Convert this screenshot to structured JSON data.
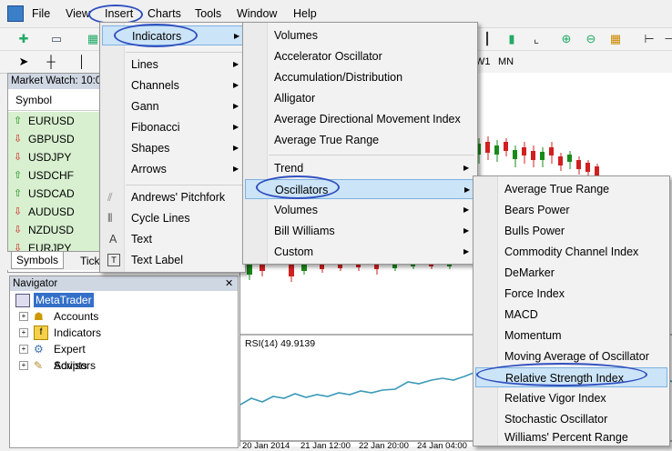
{
  "menubar": {
    "file": "File",
    "view": "View",
    "insert": "Insert",
    "charts": "Charts",
    "tools": "Tools",
    "window": "Window",
    "help": "Help"
  },
  "chart_toolbar": {
    "w1": "W1",
    "mn": "MN"
  },
  "market_watch": {
    "title": "Market Watch: 10:0",
    "column": "Symbol",
    "symbols": [
      {
        "name": "EURUSD",
        "dir": "up"
      },
      {
        "name": "GBPUSD",
        "dir": "down"
      },
      {
        "name": "USDJPY",
        "dir": "down"
      },
      {
        "name": "USDCHF",
        "dir": "up"
      },
      {
        "name": "USDCAD",
        "dir": "up"
      },
      {
        "name": "AUDUSD",
        "dir": "down"
      },
      {
        "name": "NZDUSD",
        "dir": "down"
      },
      {
        "name": "EURJPY",
        "dir": "down"
      }
    ],
    "tabs": [
      "Symbols",
      "Tick"
    ]
  },
  "navigator": {
    "title": "Navigator",
    "root": "MetaTrader",
    "items": [
      "Accounts",
      "Indicators",
      "Expert Advisors",
      "Scripts"
    ]
  },
  "chart": {
    "rsi_label": "RSI(14) 49.9139",
    "time_labels": [
      "20 Jan 2014",
      "21 Jan 12:00",
      "22 Jan 20:00",
      "24 Jan 04:00"
    ]
  },
  "insert_menu": {
    "items": [
      "Indicators",
      "Lines",
      "Channels",
      "Gann",
      "Fibonacci",
      "Shapes",
      "Arrows",
      "Andrews' Pitchfork",
      "Cycle Lines",
      "Text",
      "Text Label"
    ]
  },
  "indicators_menu": {
    "items": [
      "Volumes",
      "Accelerator Oscillator",
      "Accumulation/Distribution",
      "Alligator",
      "Average Directional Movement Index",
      "Average True Range",
      "Trend",
      "Oscillators",
      "Volumes",
      "Bill Williams",
      "Custom"
    ]
  },
  "oscillators_menu": {
    "items": [
      "Average True Range",
      "Bears Power",
      "Bulls Power",
      "Commodity Channel Index",
      "DeMarker",
      "Force Index",
      "MACD",
      "Momentum",
      "Moving Average of Oscillator",
      "Relative Strength Index",
      "Relative Vigor Index",
      "Stochastic Oscillator",
      "Williams' Percent Range"
    ]
  },
  "colors": {
    "highlight": "#cce4f7",
    "annotation": "#3050c0",
    "symbol_bg": "#d8f0d0",
    "up": "#1a8a1a",
    "down": "#d02020",
    "rsi_line": "#3a9ab8"
  }
}
